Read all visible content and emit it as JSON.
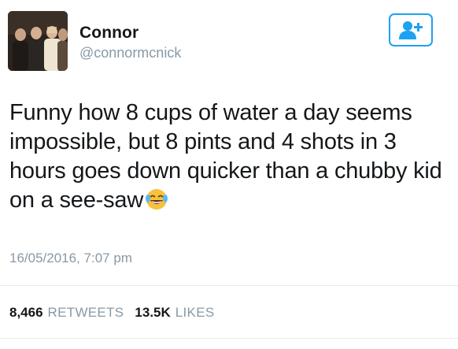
{
  "user": {
    "name": "Connor",
    "handle": "@connormcnick"
  },
  "follow_button": {
    "icon": "add-user-icon",
    "color": "#1da1f2"
  },
  "tweet": {
    "text": "Funny how 8 cups of water a day seems impossible, but 8 pints and 4 shots in 3 hours goes down quicker than a chubby kid on a see-saw",
    "emoji": "face-with-tears-of-joy-icon",
    "timestamp": "16/05/2016, 7:07 pm"
  },
  "stats": {
    "retweets_count": "8,466",
    "retweets_label": "RETWEETS",
    "likes_count": "13.5K",
    "likes_label": "LIKES"
  }
}
